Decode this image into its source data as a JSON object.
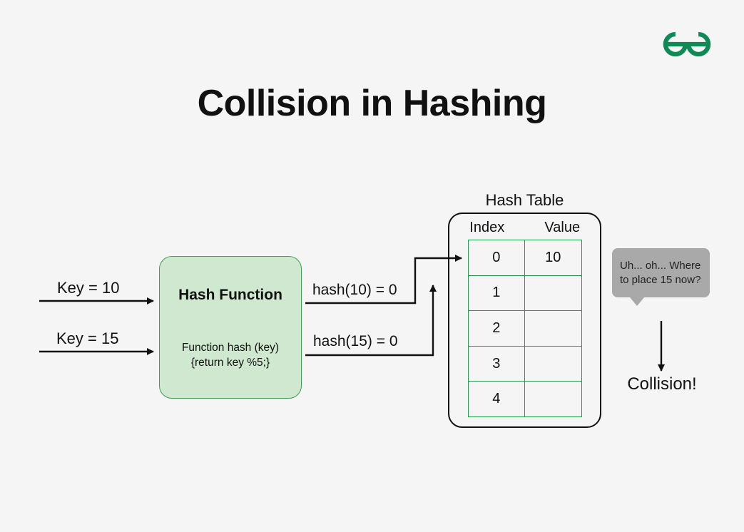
{
  "title": "Collision in Hashing",
  "keys": [
    {
      "label": "Key = 10"
    },
    {
      "label": "Key = 15"
    }
  ],
  "hash_function": {
    "title": "Hash Function",
    "code_line1": "Function hash (key)",
    "code_line2": "{return key %5;}"
  },
  "hash_outputs": [
    {
      "label": "hash(10) = 0"
    },
    {
      "label": "hash(15) = 0"
    }
  ],
  "hash_table": {
    "label": "Hash Table",
    "headers": {
      "index": "Index",
      "value": "Value"
    },
    "rows": [
      {
        "index": "0",
        "value": "10"
      },
      {
        "index": "1",
        "value": ""
      },
      {
        "index": "2",
        "value": ""
      },
      {
        "index": "3",
        "value": ""
      },
      {
        "index": "4",
        "value": ""
      }
    ]
  },
  "bubble_text": "Uh... oh... Where to place 15 now?",
  "collision_label": "Collision!",
  "colors": {
    "brand_green": "#0f8a56",
    "fn_fill": "#cfe8cf",
    "fn_border": "#3d9e56",
    "table_border": "#259a4a",
    "bubble_bg": "#a9a9a9"
  }
}
